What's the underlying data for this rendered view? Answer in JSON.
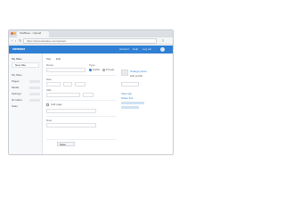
{
  "browser": {
    "tab_title": "SiteBase - Upload",
    "url": "https://www.sitebase.com/upload"
  },
  "header": {
    "brand": "siteBase",
    "links": [
      "Account",
      "Help",
      "Log out"
    ]
  },
  "sidebar": {
    "title": "My Sites",
    "new_button": "New Site",
    "items": [
      "My Sites",
      "Pages",
      "Media",
      "Settings",
      "Domains",
      "Stats"
    ]
  },
  "main": {
    "breadcrumb": [
      "Site",
      "Edit"
    ],
    "fields": {
      "name_label": "Name",
      "type_label": "Type",
      "options": [
        "Public",
        "Private"
      ],
      "size_label": "Size",
      "url_label": "URL",
      "checkbox_label": "Add page",
      "note_label": "Note"
    },
    "right_panel": {
      "links": [
        "Change photo",
        "Edit profile",
        "View site",
        "Share link"
      ]
    },
    "save_label": "Save"
  },
  "colors": {
    "accent": "#2f7fd4",
    "sidebar_bg": "#f7f8fa"
  }
}
